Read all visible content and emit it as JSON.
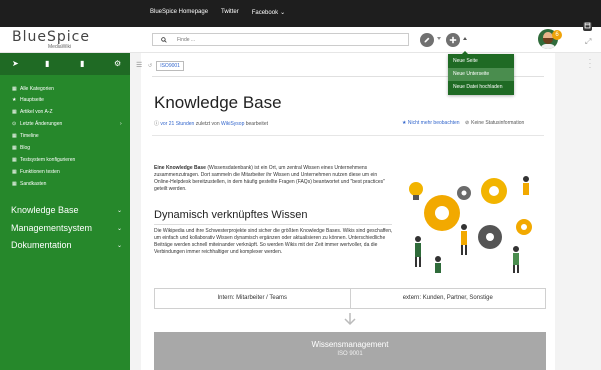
{
  "topbar": {
    "links": [
      "BlueSpice Homepage",
      "Twitter",
      "Facebook"
    ],
    "facebook_caret": "⌄"
  },
  "header": {
    "logo_name": "BlueSpice",
    "logo_sub": "MediaWiki",
    "search_placeholder": "Finde ...",
    "notification_count": "6"
  },
  "dropdown": {
    "items": [
      "Neue Seite",
      "Neue Unterseite",
      "Neue Datei hochladen"
    ],
    "highlighted_index": 1
  },
  "sidebar": {
    "items": [
      {
        "icon": "▦",
        "label": "Alle Kategorien"
      },
      {
        "icon": "★",
        "label": "Hauptseite"
      },
      {
        "icon": "▦",
        "label": "Artikel von A-Z"
      },
      {
        "icon": "⊙",
        "label": "Letzte Änderungen"
      },
      {
        "icon": "▦",
        "label": "Timeline"
      },
      {
        "icon": "▦",
        "label": "Blog"
      },
      {
        "icon": "▦",
        "label": "Testsystem konfigurieren"
      },
      {
        "icon": "▦",
        "label": "Funktionen testen"
      },
      {
        "icon": "▦",
        "label": "Sandkasten"
      }
    ],
    "sections": [
      "Knowledge Base",
      "Managementsystem",
      "Dokumentation"
    ]
  },
  "breadcrumb": {
    "tag": "ISO9001"
  },
  "page": {
    "title": "Knowledge Base",
    "meta_prefix": "vor 21 Stunden",
    "meta_middle": " zuletzt von ",
    "meta_user": "WikiSysop",
    "meta_suffix": " bearbeitet",
    "watch_label": "Nicht mehr beobachten",
    "status_label": "Keine Statusinformation",
    "intro_bold": "Eine Knowledge Base",
    "intro_rest": " (Wissensdatenbank) ist ein Ort, um zentral Wissen eines Unternehmens zusammenzutragen. Dort sammeln die Mitarbeiter ihr Wissen und Unternehmen nutzen diese um ein Online-Helpdesk bereitzustellen, in dem häufig gestellte Fragen (FAQs) beantwortet und \"best practices\" geteilt werden.",
    "h2": "Dynamisch verknüpftes Wissen",
    "paragraph": "Die Wikipedia und ihre Schwesterprojekte sind sicher die größten Knowledge Bases. Wikis sind geschaffen, um einfach und kollaborativ Wissen dynamisch ergänzen oder aktualisieren zu können. Unterschiedliche Beiträge werden schnell miteinander verknüpft. So werden Wikis mit der Zeit immer wertvoller, da die Verbindungen immer reichhaltiger und komplexer werden.",
    "table": [
      "Intern: Mitarbeiter / Teams",
      "extern: Kunden, Partner, Sonstige"
    ],
    "box_title": "Wissensmanagement",
    "box_sub": "ISO 9001"
  },
  "colors": {
    "sidebar_green": "#26882b",
    "sidebar_dark_green": "#1f6a24",
    "link_blue": "#3366cc",
    "grey_box": "#a8a8a8"
  }
}
